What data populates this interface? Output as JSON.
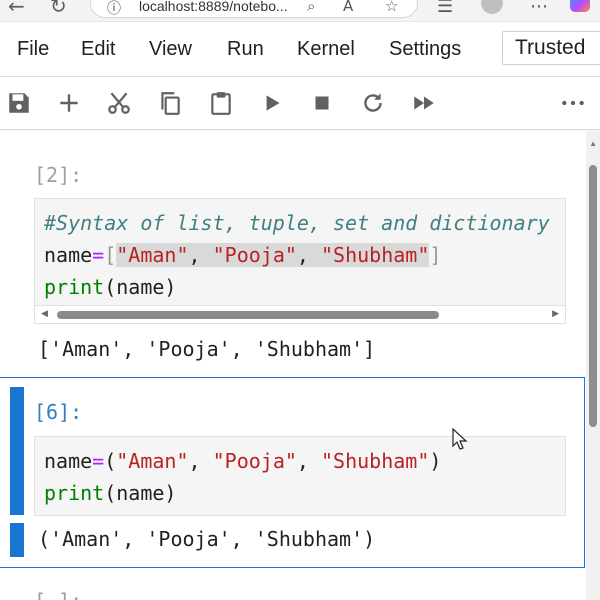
{
  "browser": {
    "url": "localhost:8889/notebo..."
  },
  "menu": {
    "items": [
      "File",
      "Edit",
      "View",
      "Run",
      "Kernel",
      "Settings"
    ],
    "trusted": "Trusted"
  },
  "toolbar": {
    "buttons": [
      "save",
      "add-cell",
      "cut",
      "copy",
      "paste",
      "run",
      "interrupt",
      "restart",
      "restart-run-all",
      "more"
    ]
  },
  "cells": [
    {
      "prompt": "[2]:",
      "lines": {
        "line1": "#Syntax of list, tuple, set and dictionary",
        "line2_name": "name",
        "line2_eq": "=",
        "line2_open": "[",
        "line2_s1": "\"Aman\"",
        "line2_c1": ", ",
        "line2_s2": "\"Pooja\"",
        "line2_c2": ", ",
        "line2_s3": "\"Shubham\"",
        "line2_close": "]",
        "line3_fn": "print",
        "line3_arg": "(name)"
      },
      "output": "['Aman', 'Pooja', 'Shubham']"
    },
    {
      "prompt": "[6]:",
      "lines": {
        "line1_name": "name",
        "line1_eq": "=",
        "line1_open": "(",
        "line1_s1": "\"Aman\"",
        "line1_c1": ", ",
        "line1_s2": "\"Pooja\"",
        "line1_c2": ", ",
        "line1_s3": "\"Shubham\"",
        "line1_close": ")",
        "line2_fn": "print",
        "line2_arg": "(name)"
      },
      "output": "('Aman', 'Pooja', 'Shubham')"
    },
    {
      "prompt": "[ ]:"
    }
  ],
  "colors": {
    "accent": "#1976d2",
    "comment": "#408080",
    "string": "#ba2121",
    "builtin": "#008000",
    "operator": "#aa22ff"
  }
}
